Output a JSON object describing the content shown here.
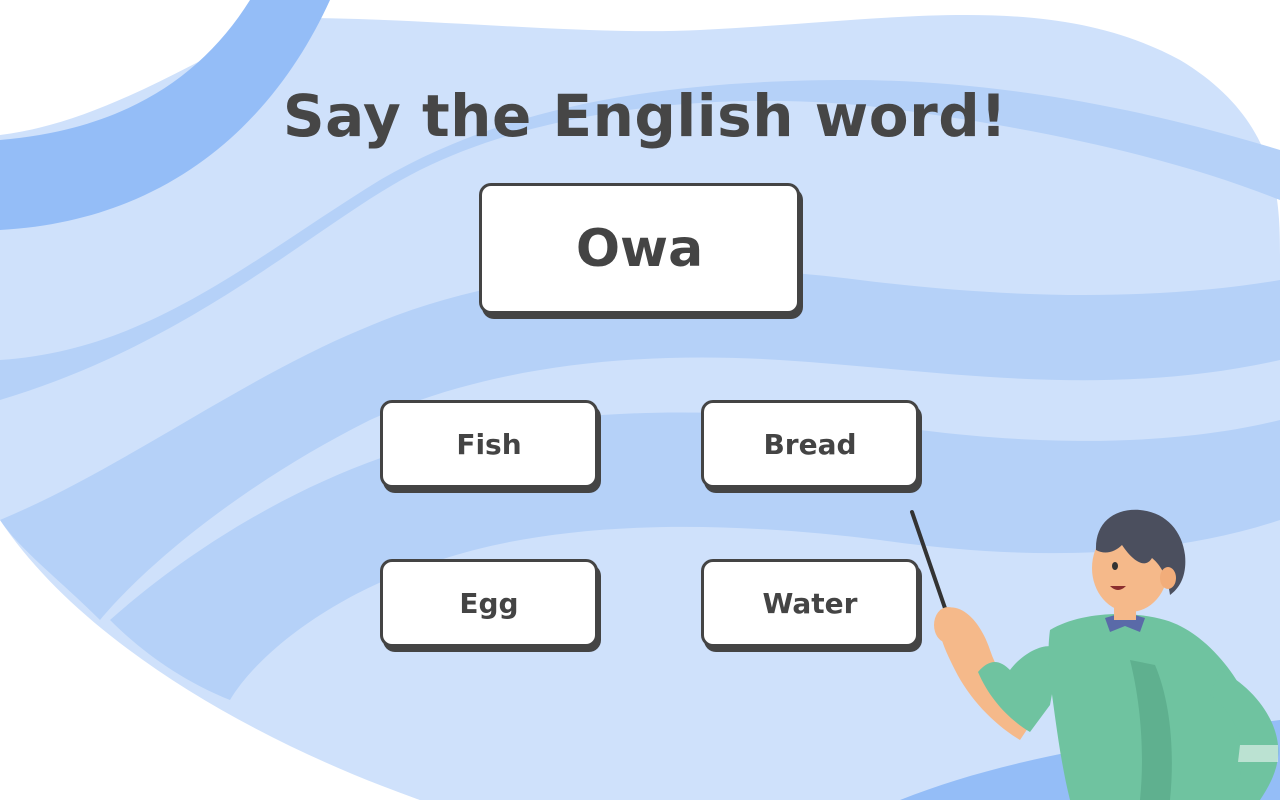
{
  "prompt": {
    "title": "Say the English word!"
  },
  "word_card": {
    "word": "Owa"
  },
  "choices": [
    {
      "label": "Fish"
    },
    {
      "label": "Bread"
    },
    {
      "label": "Egg"
    },
    {
      "label": "Water"
    }
  ],
  "colors": {
    "background_light": "#cfe1fb",
    "background_mid": "#b5d1f8",
    "background_dark": "#94bdf7",
    "text": "#464646",
    "card_border": "#444444",
    "sweater": "#6fc3a0",
    "hair": "#4b4f5e"
  },
  "icons": {
    "teacher": "teacher-with-pointer-illustration"
  }
}
